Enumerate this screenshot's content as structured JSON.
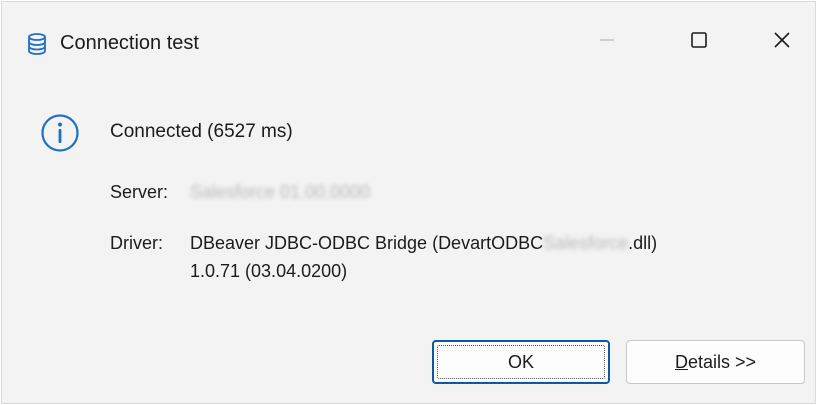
{
  "window": {
    "title": "Connection test",
    "controls": {
      "minimize": "minimize",
      "maximize": "maximize",
      "close": "close"
    }
  },
  "status": {
    "icon": "info-icon",
    "text": "Connected (6527 ms)"
  },
  "details": {
    "server_label": "Server:",
    "server_value": "Salesforce 01.00.0000",
    "driver_label": "Driver:",
    "driver_prefix": "DBeaver JDBC-ODBC Bridge (DevartODBC",
    "driver_hidden": "Salesforce",
    "driver_suffix": ".dll)",
    "driver_version": "1.0.71 (03.04.0200)"
  },
  "buttons": {
    "ok_label": "OK",
    "details_mnemonic": "D",
    "details_rest": "etails >>"
  },
  "colors": {
    "accent": "#0a59a8",
    "icon_blue": "#1f6fc5",
    "window_bg": "#f3f3f3"
  }
}
